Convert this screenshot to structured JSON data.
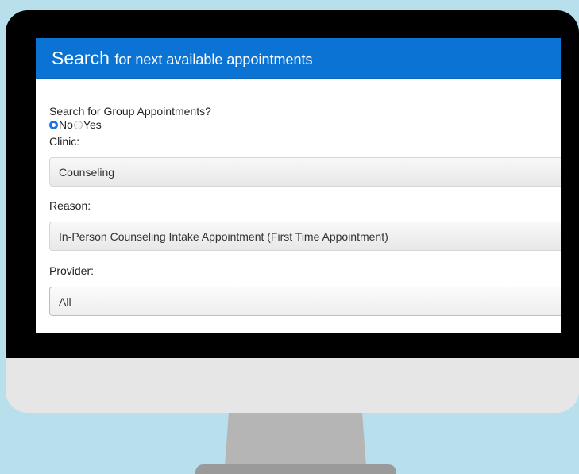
{
  "header": {
    "title_strong": "Search",
    "title_rest": "for next available appointments",
    "color": "#0b73d4"
  },
  "group_search": {
    "label": "Search for Group Appointments?",
    "options": [
      {
        "label": "No",
        "selected": true
      },
      {
        "label": "Yes",
        "selected": false
      }
    ]
  },
  "clinic": {
    "label": "Clinic:",
    "value": "Counseling"
  },
  "reason": {
    "label": "Reason:",
    "value": "In-Person Counseling Intake Appointment (First Time Appointment)"
  },
  "provider": {
    "label": "Provider:",
    "value": "All"
  }
}
